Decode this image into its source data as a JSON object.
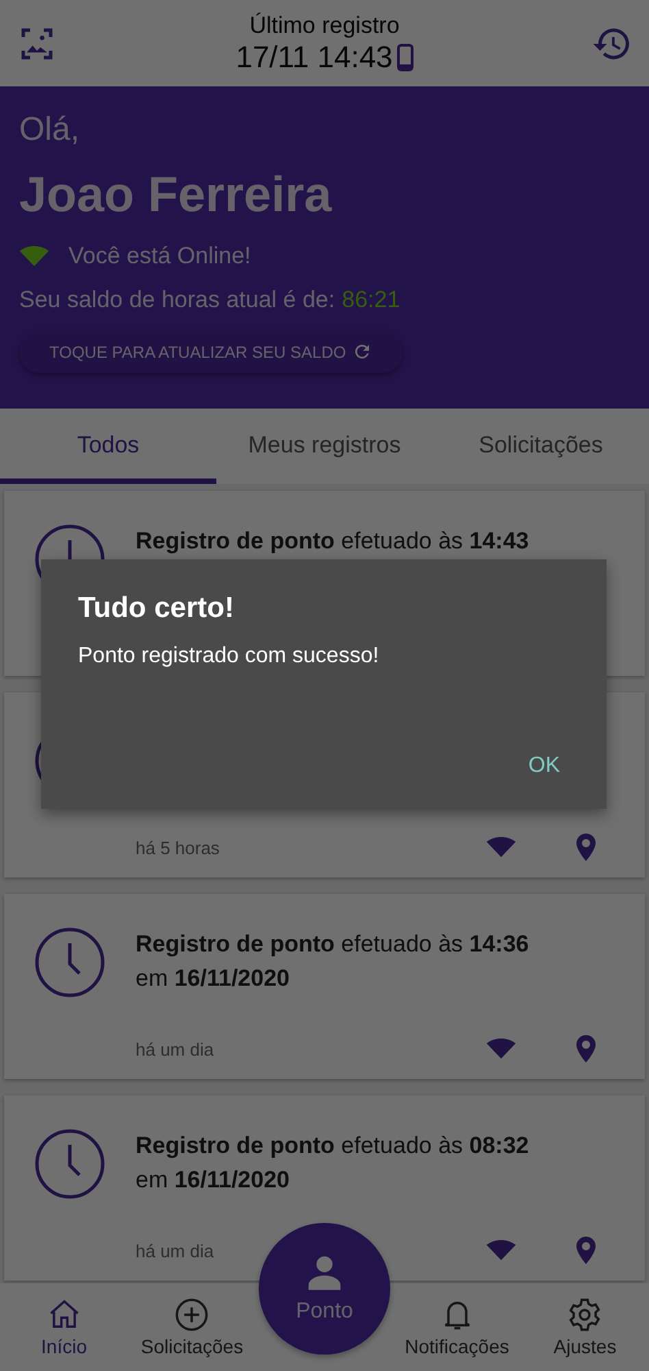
{
  "header": {
    "title": "Último registro",
    "last_time": "17/11 14:43"
  },
  "greeting": {
    "hello": "Olá,",
    "name": "Joao Ferreira",
    "online": true,
    "status": "Você está Online!",
    "balance_label": "Seu saldo de horas atual é de:",
    "balance": "86:21",
    "refresh_button": "TOQUE PARA ATUALIZAR SEU SALDO"
  },
  "tabs": [
    {
      "label": "Todos",
      "selected": true
    },
    {
      "label": "Meus registros",
      "selected": false
    },
    {
      "label": "Solicitações",
      "selected": false
    }
  ],
  "records": [
    {
      "line1": "**Registro de ponto** efetuado às **14:43**"
    },
    {
      "time": "há 5 horas"
    },
    {
      "line1": "**Registro de ponto** efetuado às **14:36**",
      "line2": "em **16/11/2020**",
      "time": "há um dia"
    },
    {
      "line1": "**Registro de ponto** efetuado às **08:32**",
      "line2": "em **16/11/2020**",
      "time": "há um dia"
    }
  ],
  "nav": [
    {
      "label": "Início",
      "selected": true
    },
    {
      "label": "Solicitações",
      "selected": false
    },
    {
      "label": "Notificações",
      "selected": false
    },
    {
      "label": "Ajustes",
      "selected": false
    }
  ],
  "fab": {
    "label": "Ponto"
  },
  "dialog": {
    "title": "Tudo certo!",
    "message": "Ponto registrado com sucesso!",
    "button": "OK"
  }
}
